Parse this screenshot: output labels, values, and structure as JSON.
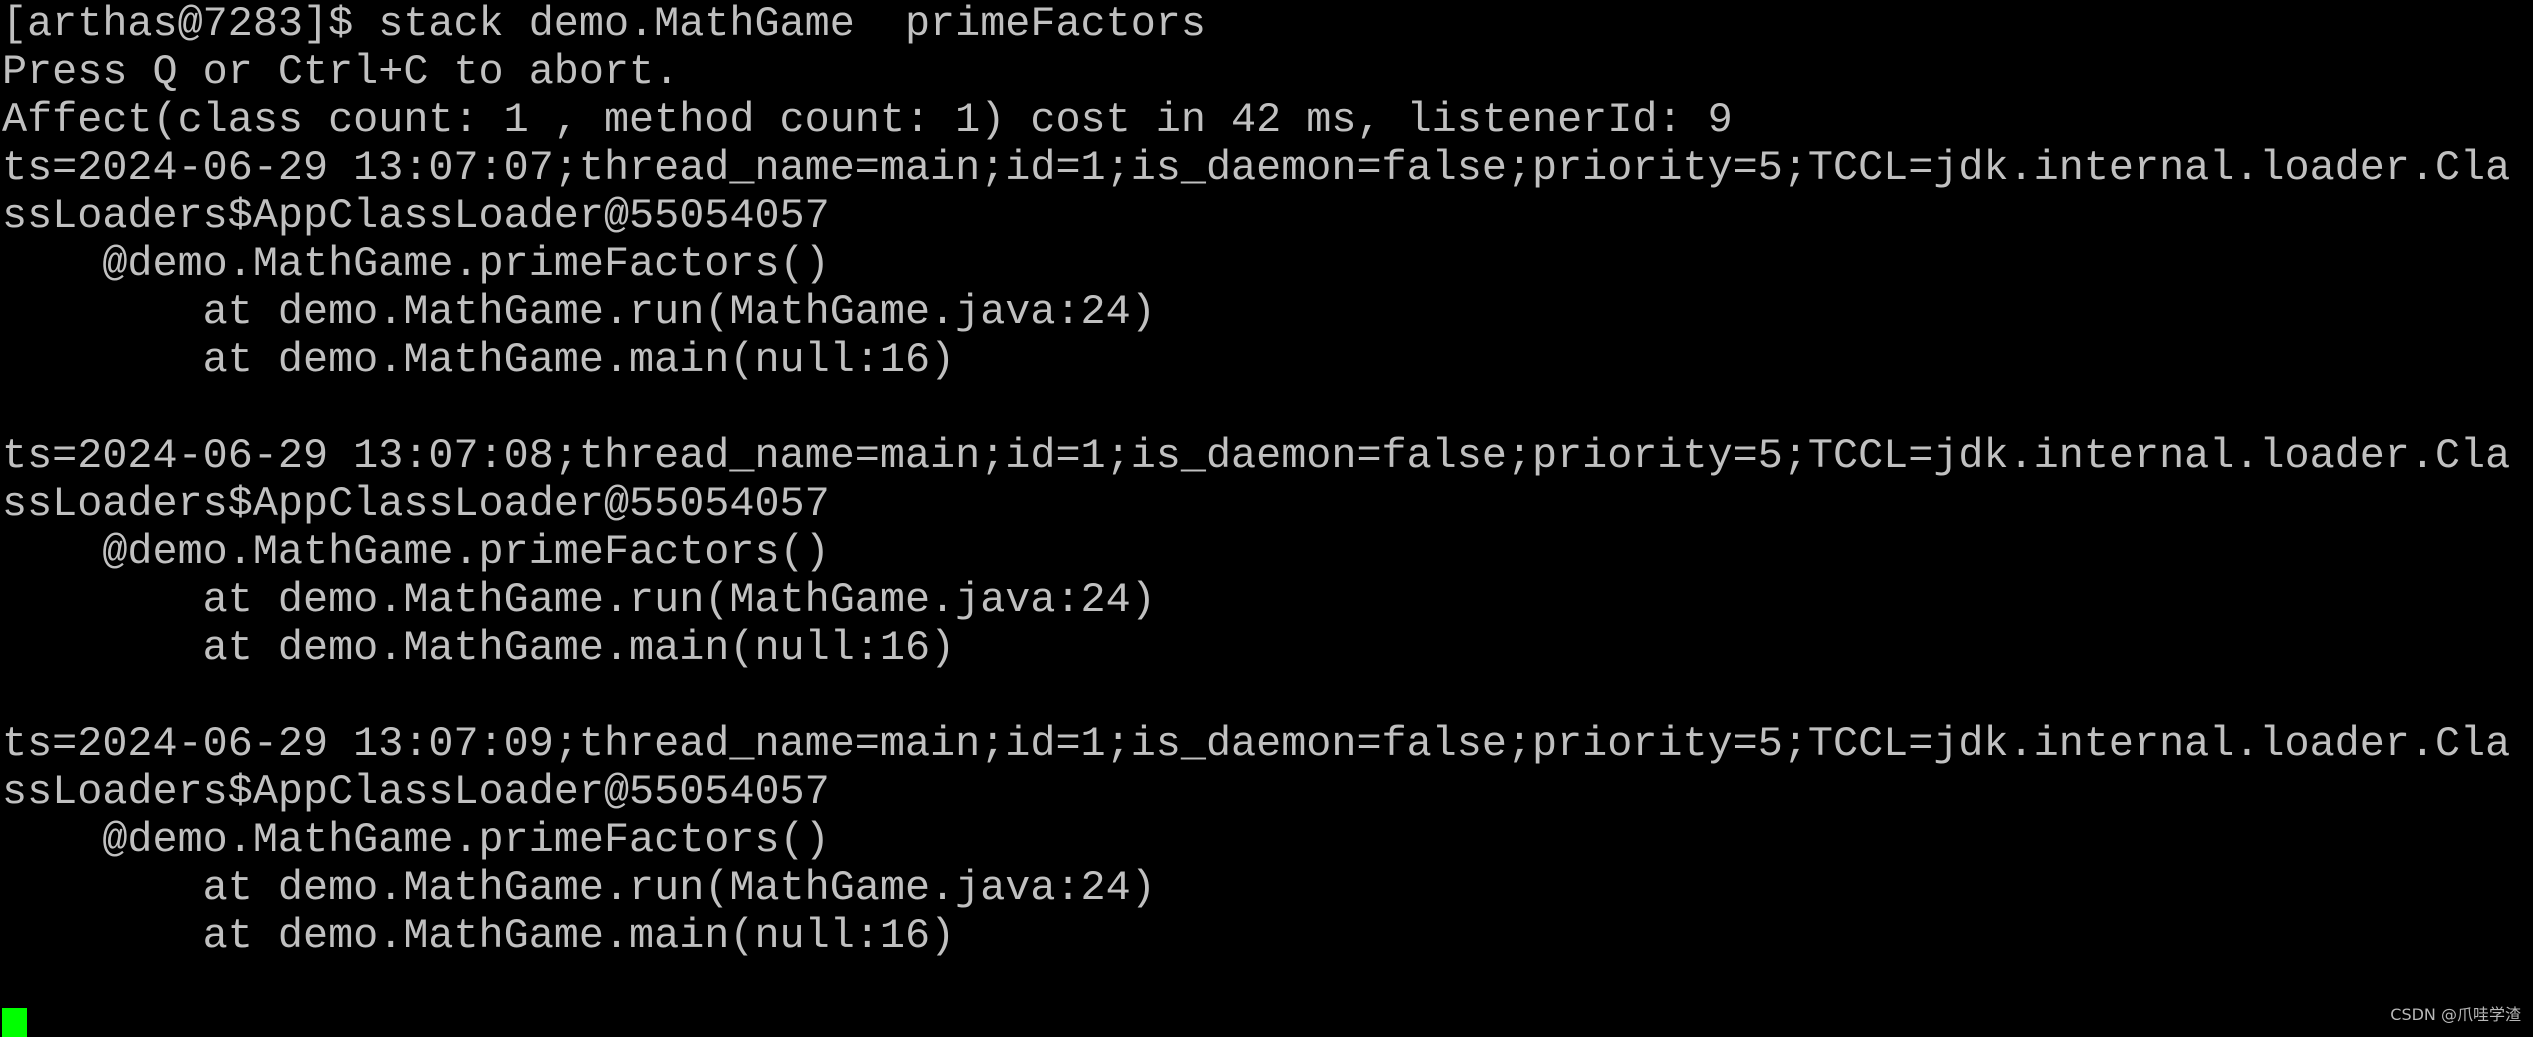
{
  "terminal": {
    "lines": [
      "[arthas@7283]$ stack demo.MathGame  primeFactors",
      "Press Q or Ctrl+C to abort.",
      "Affect(class count: 1 , method count: 1) cost in 42 ms, listenerId: 9",
      "ts=2024-06-29 13:07:07;thread_name=main;id=1;is_daemon=false;priority=5;TCCL=jdk.internal.loader.Cla",
      "ssLoaders$AppClassLoader@55054057",
      "    @demo.MathGame.primeFactors()",
      "        at demo.MathGame.run(MathGame.java:24)",
      "        at demo.MathGame.main(null:16)",
      "",
      "ts=2024-06-29 13:07:08;thread_name=main;id=1;is_daemon=false;priority=5;TCCL=jdk.internal.loader.Cla",
      "ssLoaders$AppClassLoader@55054057",
      "    @demo.MathGame.primeFactors()",
      "        at demo.MathGame.run(MathGame.java:24)",
      "        at demo.MathGame.main(null:16)",
      "",
      "ts=2024-06-29 13:07:09;thread_name=main;id=1;is_daemon=false;priority=5;TCCL=jdk.internal.loader.Cla",
      "ssLoaders$AppClassLoader@55054057",
      "    @demo.MathGame.primeFactors()",
      "        at demo.MathGame.run(MathGame.java:24)",
      "        at demo.MathGame.main(null:16)",
      ""
    ],
    "text_color": "#c0c0c0",
    "background": "#000000",
    "cursor_color": "#00ff00"
  },
  "watermark": "CSDN @爪哇学渣"
}
